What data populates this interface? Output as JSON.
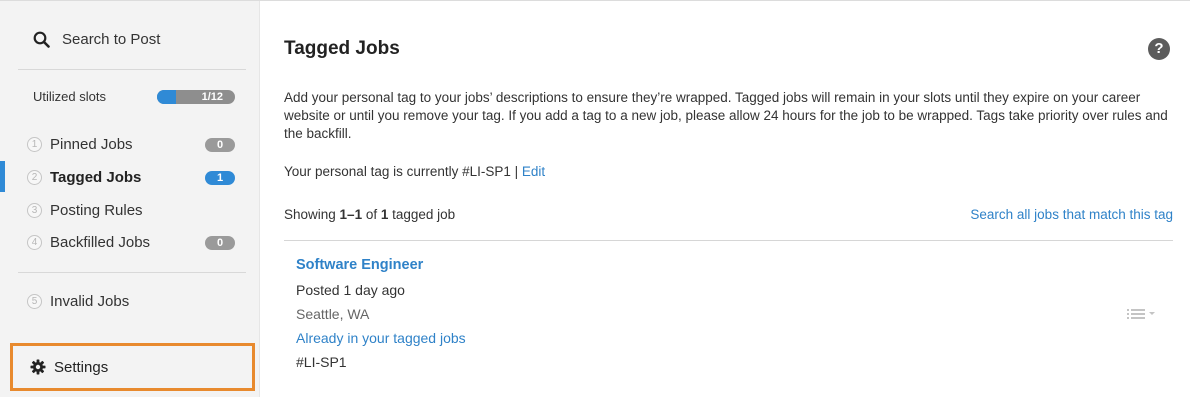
{
  "sidebar": {
    "search_label": "Search to Post",
    "slots": {
      "label": "Utilized slots",
      "used": 1,
      "total": 12,
      "text": "1/12"
    },
    "items": [
      {
        "num": "1",
        "label": "Pinned Jobs",
        "badge": "0",
        "active": false
      },
      {
        "num": "2",
        "label": "Tagged Jobs",
        "badge": "1",
        "active": true
      },
      {
        "num": "3",
        "label": "Posting Rules",
        "badge": null,
        "active": false
      },
      {
        "num": "4",
        "label": "Backfilled Jobs",
        "badge": "0",
        "active": false
      },
      {
        "num": "5",
        "label": "Invalid Jobs",
        "badge": null,
        "active": false
      }
    ],
    "settings_label": "Settings"
  },
  "main": {
    "title": "Tagged Jobs",
    "help_icon": "?",
    "description": "Add your personal tag to your jobs’ descriptions to ensure they’re wrapped. Tagged jobs will remain in your slots until they expire on your career website or until you remove your tag. If you add a tag to a new job, please allow 24 hours for the job to be wrapped. Tags take priority over rules and the backfill.",
    "tag_prefix": "Your personal tag is currently #LI-SP1 | ",
    "edit_label": "Edit",
    "showing": {
      "prefix": "Showing ",
      "range": "1–1",
      "of": " of ",
      "count": "1",
      "suffix": " tagged job"
    },
    "search_all_label": "Search all jobs that match this tag",
    "job": {
      "title": "Software Engineer",
      "posted": "Posted 1 day ago",
      "location": "Seattle, WA",
      "status": "Already in your tagged jobs",
      "tag": "#LI-SP1"
    }
  },
  "colors": {
    "accent": "#2f82c8",
    "highlight_border": "#e88a2e",
    "sidebar_bg": "#f3f3f3"
  },
  "icons": {
    "search": "search-icon",
    "settings": "gear-icon",
    "help": "help-icon",
    "row_menu": "list-menu-icon"
  }
}
